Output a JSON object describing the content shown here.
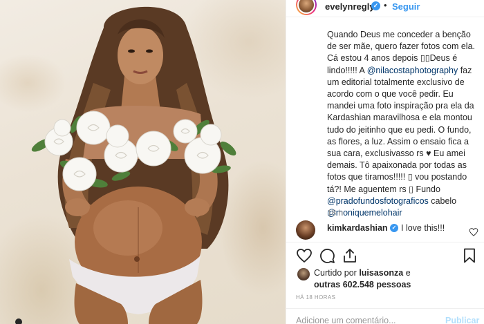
{
  "post": {
    "image_alt": "Pregnant woman holding white roses",
    "media_indicator_icon": "media-dot-icon"
  },
  "header": {
    "username": "evelynregly",
    "verified_icon": "verified-badge-icon",
    "separator": "•",
    "follow_label": "Seguir"
  },
  "caption": {
    "part1": "Quando Deus me conceder a benção de ser mãe, quero fazer fotos com ela. Cá estou 4 anos depois ",
    "emoji1": "▯▯",
    "part2": "Deus é lindo!!!!! A ",
    "mention1": "@nilacostaphotography",
    "part3": " faz um editorial totalmente exclusivo de acordo com o que você pedir. Eu mandei uma foto inspiração pra ela da Kardashian maravilhosa e ela montou tudo do jeitinho que eu pedi. O fundo, as flores, a luz. Assim o ensaio fica a sua cara, exclusivasso rs ",
    "heart": "♥",
    "part4": " Eu amei demais. Tô apaixonada por todas as fotos que tiramos!!!!! ",
    "emoji2": "▯",
    "part5": " vou postando tá?! Me aguentem rs ",
    "emoji3": "▯",
    "part6": " Fundo ",
    "mention2": "@pradofundosfotograficos",
    "part7": " cabelo ",
    "mention3": "@moniquemelohair",
    "time": "18 h"
  },
  "comment": {
    "username": "kimkardashian",
    "text": "I love this!!!",
    "like_icon": "heart-outline-icon"
  },
  "actions": {
    "like_icon": "heart-outline-icon",
    "comment_icon": "comment-bubble-icon",
    "share_icon": "share-icon",
    "save_icon": "bookmark-icon"
  },
  "likes": {
    "prefix": "Curtido por ",
    "user": "luisasonza",
    "joiner": " e",
    "others_prefix": "outras ",
    "count": "602.548",
    "others_suffix": " pessoas"
  },
  "time_ago": "HÁ 18 HORAS",
  "comment_box": {
    "placeholder": "Adicione um comentário...",
    "publish_label": "Publicar"
  },
  "colors": {
    "link": "#003569",
    "accent": "#3897f0",
    "publish_disabled": "#b2dffc",
    "muted": "#999999",
    "text": "#262626"
  }
}
